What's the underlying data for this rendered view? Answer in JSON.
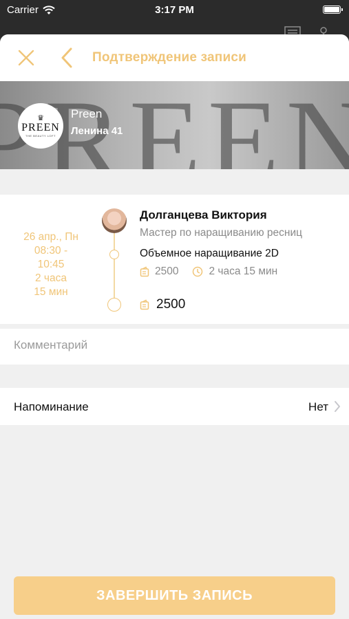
{
  "status_bar": {
    "carrier": "Carrier",
    "time": "3:17 PM"
  },
  "nav": {
    "title": "Подтверждение записи"
  },
  "salon": {
    "logo_text": "PREEN",
    "logo_subtitle": "THE BEAUTY LOFT",
    "name": "Preen",
    "address": "Ленина 41"
  },
  "appointment": {
    "date": "26 апр., Пн",
    "time_range": "08:30 - 10:45",
    "duration_line1": "2 часа",
    "duration_line2": "15 мин",
    "master_name": "Долганцева Виктория",
    "master_role": "Мастер по наращиванию ресниц",
    "service_name": "Объемное наращивание 2D",
    "service_price": "2500",
    "service_duration": "2 часа 15 мин",
    "total_price": "2500"
  },
  "comment": {
    "placeholder": "Комментарий"
  },
  "reminder": {
    "label": "Напоминание",
    "value": "Нет"
  },
  "finish_button": {
    "label": "ЗАВЕРШИТЬ ЗАПИСЬ"
  },
  "colors": {
    "accent": "#f0c578",
    "button": "#f7cf8a",
    "background": "#f0f0f0"
  }
}
